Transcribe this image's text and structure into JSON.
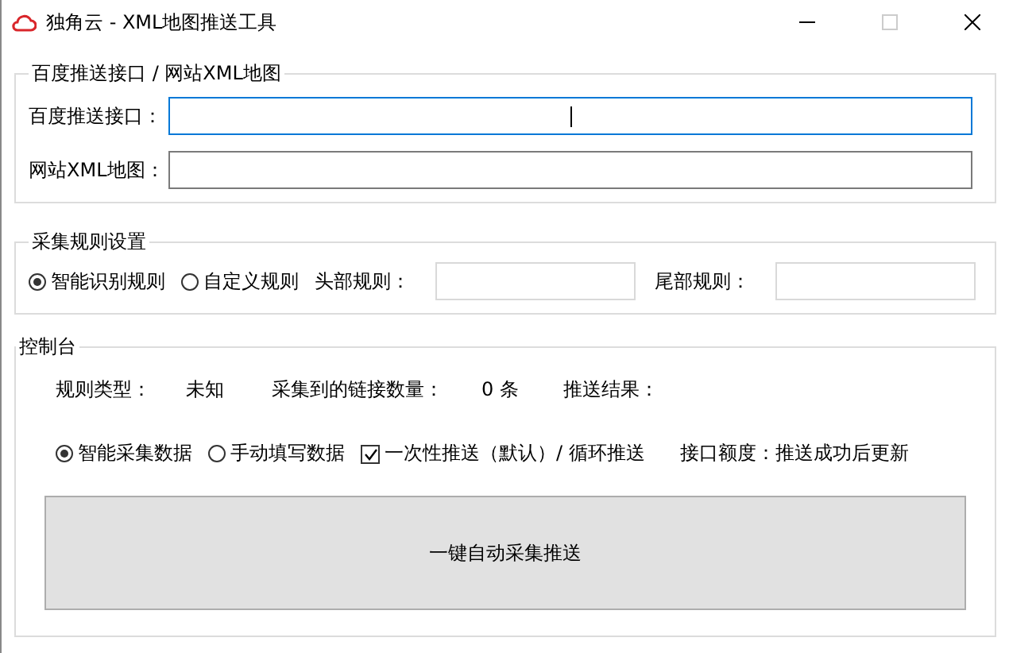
{
  "window": {
    "title": "独角云 - XML地图推送工具"
  },
  "push_group": {
    "title": "百度推送接口 / 网站XML地图",
    "fields": [
      {
        "label": "百度推送接口：",
        "focused": true
      },
      {
        "label": "网站XML地图：",
        "focused": false
      }
    ]
  },
  "rule_group": {
    "title": "采集规则设置",
    "options": [
      {
        "label": "智能识别规则",
        "selected": true
      },
      {
        "label": "自定义规则",
        "selected": false
      }
    ],
    "fields": [
      {
        "label": "头部规则："
      },
      {
        "label": "尾部规则："
      }
    ]
  },
  "console": {
    "title": "控制台",
    "stats": [
      {
        "label": "规则类型：",
        "value": "未知"
      },
      {
        "label": "采集到的链接数量：",
        "value": "0 条"
      },
      {
        "label": "推送结果："
      }
    ],
    "modes": [
      {
        "label": "智能采集数据",
        "selected": true
      },
      {
        "label": "手动填写数据",
        "selected": false
      }
    ],
    "once_push": {
      "label": "一次性推送（默认）/ 循环推送",
      "checked": true
    },
    "quota": "接口额度：推送成功后更新",
    "action_button": "一键自动采集推送"
  }
}
